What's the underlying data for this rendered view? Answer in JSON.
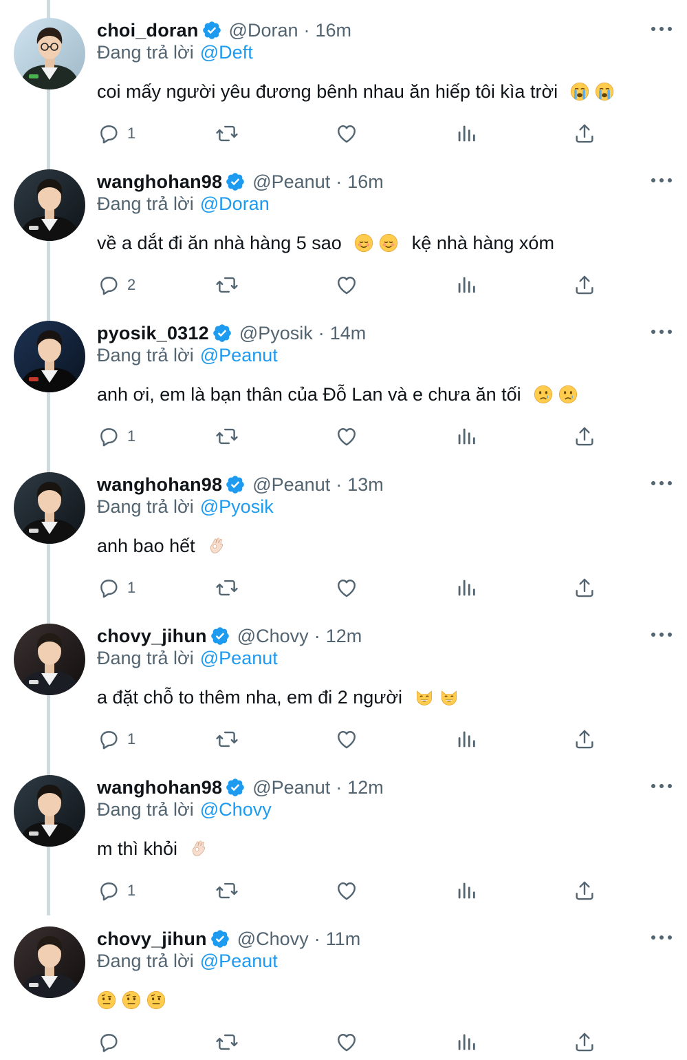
{
  "replying_prefix": "Đang trả lời",
  "separator": "·",
  "colors": {
    "text": "#0f1419",
    "secondary": "#536471",
    "link": "#1d9bf0",
    "verified": "#1d9bf0",
    "thread_line": "#cfd9de"
  },
  "tweets": [
    {
      "name": "choi_doran",
      "handle": "@Doran",
      "time": "16m",
      "reply_to": "@Deft",
      "text": "coi mấy người yêu đương bênh nhau ăn hiếp tôi kìa trời",
      "emojis": [
        "loudly-crying-face",
        "loudly-crying-face"
      ],
      "reply_count": "1"
    },
    {
      "name": "wanghohan98",
      "handle": "@Peanut",
      "time": "16m",
      "reply_to": "@Doran",
      "text": "về a dắt đi ăn nhà hàng 5 sao",
      "emojis": [
        "smiling-face",
        "smiling-face"
      ],
      "text_after": "kệ nhà hàng xóm",
      "reply_count": "2"
    },
    {
      "name": "pyosik_0312",
      "handle": "@Pyosik",
      "time": "14m",
      "reply_to": "@Peanut",
      "text": "anh ơi, em là bạn thân của Đỗ Lan và e chưa ăn tối",
      "emojis": [
        "crying-face",
        "crying-face"
      ],
      "reply_count": "1"
    },
    {
      "name": "wanghohan98",
      "handle": "@Peanut",
      "time": "13m",
      "reply_to": "@Pyosik",
      "text": "anh bao hết",
      "emojis": [
        "ok-hand"
      ],
      "reply_count": "1"
    },
    {
      "name": "chovy_jihun",
      "handle": "@Chovy",
      "time": "12m",
      "reply_to": "@Peanut",
      "text": "a đặt chỗ to thêm nha, em đi 2 người",
      "emojis": [
        "grinning-cat",
        "grinning-cat"
      ],
      "reply_count": "1"
    },
    {
      "name": "wanghohan98",
      "handle": "@Peanut",
      "time": "12m",
      "reply_to": "@Chovy",
      "text": "m thì khỏi",
      "emojis": [
        "ok-hand"
      ],
      "reply_count": "1"
    },
    {
      "name": "chovy_jihun",
      "handle": "@Chovy",
      "time": "11m",
      "reply_to": "@Peanut",
      "text": "",
      "emojis": [
        "face-with-raised-eyebrow",
        "face-with-raised-eyebrow",
        "face-with-raised-eyebrow"
      ],
      "reply_count": ""
    }
  ]
}
